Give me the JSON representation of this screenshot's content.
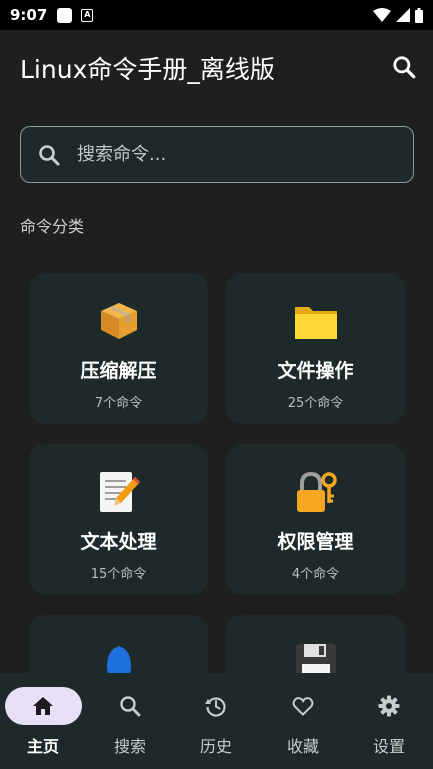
{
  "status_bar": {
    "time": "9:07",
    "a_label": "A"
  },
  "app_bar": {
    "title": "Linux命令手册_离线版"
  },
  "search": {
    "placeholder": "搜索命令..."
  },
  "section": {
    "title": "命令分类"
  },
  "categories": [
    {
      "name": "压缩解压",
      "count": "7个命令",
      "icon": "package-icon"
    },
    {
      "name": "文件操作",
      "count": "25个命令",
      "icon": "folder-icon"
    },
    {
      "name": "文本处理",
      "count": "15个命令",
      "icon": "memo-icon"
    },
    {
      "name": "权限管理",
      "count": "4个命令",
      "icon": "lock-key-icon"
    },
    {
      "name": "",
      "count": "",
      "icon": "blue-drop-icon"
    },
    {
      "name": "",
      "count": "",
      "icon": "floppy-disk-icon"
    }
  ],
  "bottom_nav": [
    {
      "label": "主页",
      "icon": "home-icon",
      "active": true
    },
    {
      "label": "搜索",
      "icon": "search-icon",
      "active": false
    },
    {
      "label": "历史",
      "icon": "history-icon",
      "active": false
    },
    {
      "label": "收藏",
      "icon": "heart-icon",
      "active": false
    },
    {
      "label": "设置",
      "icon": "gear-icon",
      "active": false
    }
  ],
  "colors": {
    "background": "#1f1f1f",
    "card": "#1d2a29",
    "nav_active_pill": "#e8dff8",
    "search_border": "#8a9a99"
  }
}
